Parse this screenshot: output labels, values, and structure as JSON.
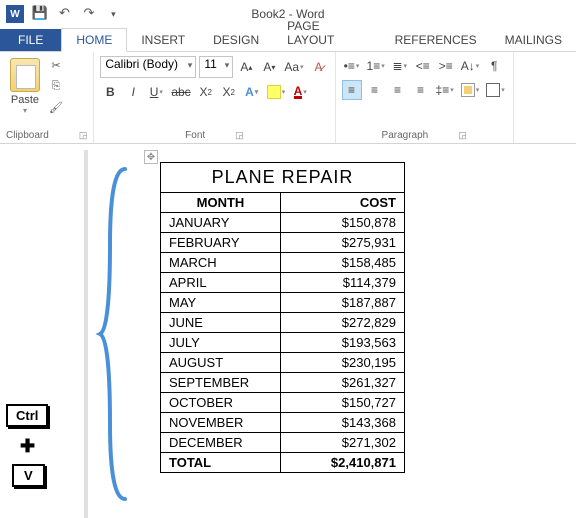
{
  "titlebar": {
    "doc_title": "Book2 - Word"
  },
  "tabs": {
    "file": "FILE",
    "home": "HOME",
    "insert": "INSERT",
    "design": "DESIGN",
    "page_layout": "PAGE LAYOUT",
    "references": "REFERENCES",
    "mailings": "MAILINGS"
  },
  "ribbon": {
    "clipboard": {
      "paste": "Paste",
      "label": "Clipboard"
    },
    "font": {
      "name": "Calibri (Body)",
      "size": "11",
      "label": "Font"
    },
    "paragraph": {
      "label": "Paragraph"
    }
  },
  "keys": {
    "ctrl": "Ctrl",
    "plus": "✚",
    "v": "V"
  },
  "table": {
    "title": "PLANE REPAIR",
    "headers": {
      "month": "MONTH",
      "cost": "COST"
    },
    "rows": [
      {
        "month": "JANUARY",
        "cost": "$150,878"
      },
      {
        "month": "FEBRUARY",
        "cost": "$275,931"
      },
      {
        "month": "MARCH",
        "cost": "$158,485"
      },
      {
        "month": "APRIL",
        "cost": "$114,379"
      },
      {
        "month": "MAY",
        "cost": "$187,887"
      },
      {
        "month": "JUNE",
        "cost": "$272,829"
      },
      {
        "month": "JULY",
        "cost": "$193,563"
      },
      {
        "month": "AUGUST",
        "cost": "$230,195"
      },
      {
        "month": "SEPTEMBER",
        "cost": "$261,327"
      },
      {
        "month": "OCTOBER",
        "cost": "$150,727"
      },
      {
        "month": "NOVEMBER",
        "cost": "$143,368"
      },
      {
        "month": "DECEMBER",
        "cost": "$271,302"
      }
    ],
    "total": {
      "label": "TOTAL",
      "cost": "$2,410,871"
    }
  }
}
